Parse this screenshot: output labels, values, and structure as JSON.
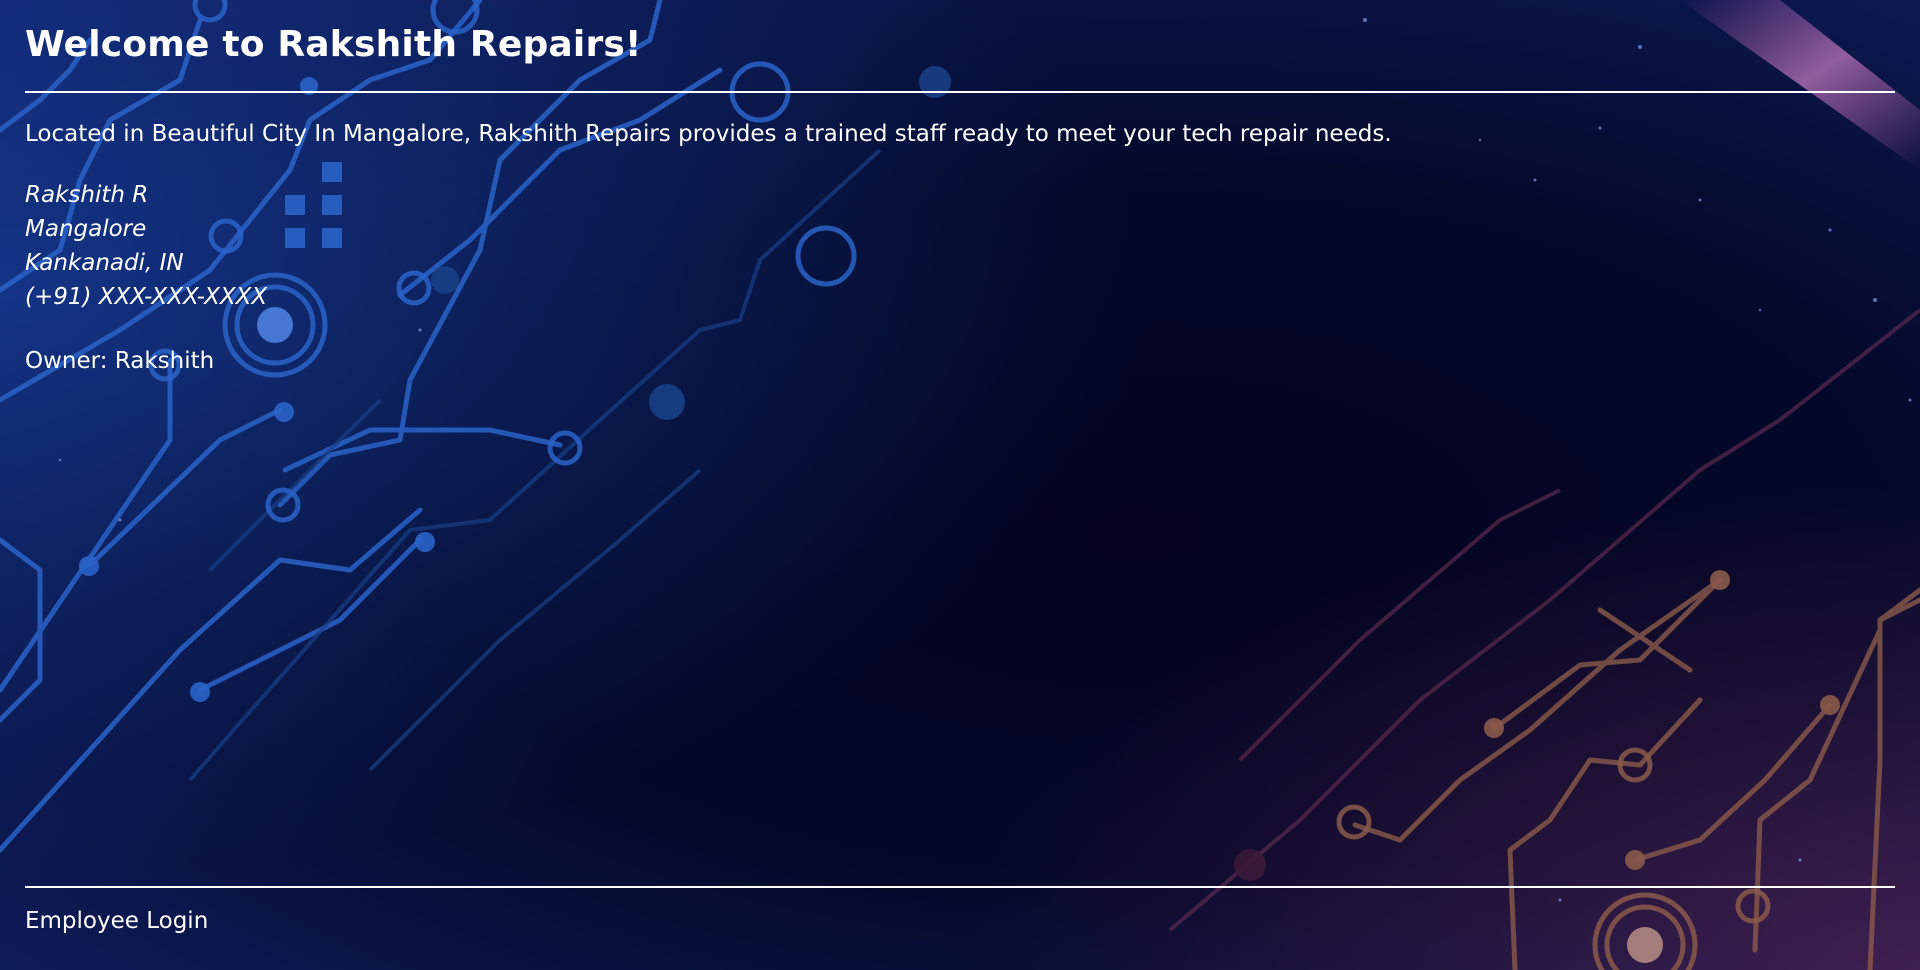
{
  "header": {
    "title": "Welcome to Rakshith Repairs!"
  },
  "main": {
    "intro": "Located in Beautiful City In Mangalore, Rakshith Repairs provides a trained staff ready to meet your tech repair needs.",
    "address": {
      "name": "Rakshith R",
      "city": "Mangalore",
      "locality": "Kankanadi, IN",
      "phone": "(+91) XXX-XXX-XXXX"
    },
    "owner": "Owner: Rakshith"
  },
  "footer": {
    "login_label": "Employee Login"
  },
  "colors": {
    "background": "#040828",
    "circuit_blue": "#2a63c9",
    "circuit_orange": "#8a5a4a",
    "text": "#ffffff"
  }
}
